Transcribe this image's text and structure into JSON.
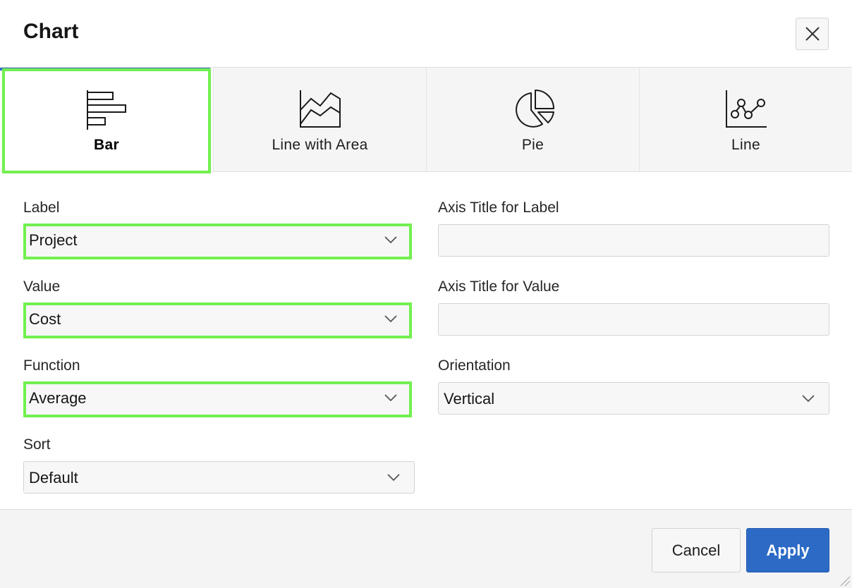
{
  "dialog": {
    "title": "Chart",
    "close_icon": "close-icon"
  },
  "chart_types": {
    "active": "Bar",
    "tabs": [
      {
        "label": "Bar",
        "icon": "bar-chart-icon",
        "selected": true
      },
      {
        "label": "Line with Area",
        "icon": "line-area-chart-icon",
        "selected": false
      },
      {
        "label": "Pie",
        "icon": "pie-chart-icon",
        "selected": false
      },
      {
        "label": "Line",
        "icon": "line-chart-icon",
        "selected": false
      }
    ]
  },
  "form": {
    "label": {
      "label": "Label",
      "value": "Project"
    },
    "value": {
      "label": "Value",
      "value": "Cost"
    },
    "function": {
      "label": "Function",
      "value": "Average"
    },
    "sort": {
      "label": "Sort",
      "value": "Default"
    },
    "axis_title_label": {
      "label": "Axis Title for Label",
      "value": ""
    },
    "axis_title_value": {
      "label": "Axis Title for Value",
      "value": ""
    },
    "orientation": {
      "label": "Orientation",
      "value": "Vertical"
    }
  },
  "footer": {
    "cancel_label": "Cancel",
    "apply_label": "Apply"
  },
  "colors": {
    "accent": "#2c6ac5",
    "highlight": "#72f050",
    "active_tab_strip": "#2f6fc4"
  }
}
